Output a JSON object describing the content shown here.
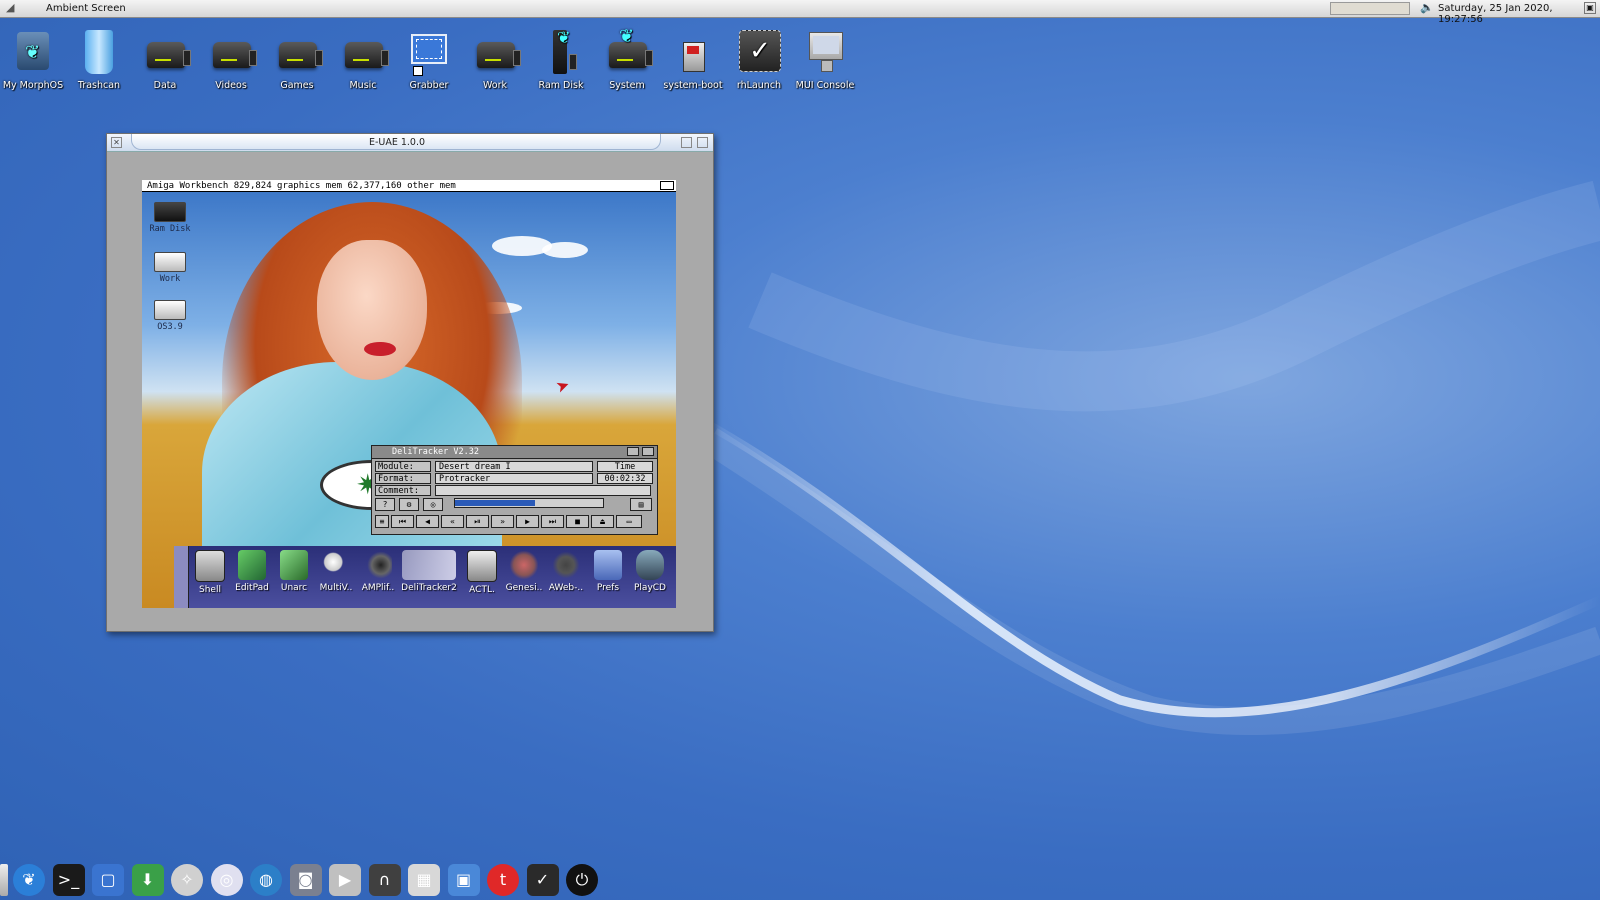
{
  "topbar": {
    "title": "Ambient Screen",
    "datetime": "Saturday, 25 Jan 2020, 19:27:56"
  },
  "desktop_icons": [
    {
      "label": "My MorphOS",
      "icon": "butterfly-icon"
    },
    {
      "label": "Trashcan",
      "icon": "trashcan-icon"
    },
    {
      "label": "Data",
      "icon": "drive-icon"
    },
    {
      "label": "Videos",
      "icon": "drive-icon"
    },
    {
      "label": "Games",
      "icon": "drive-icon"
    },
    {
      "label": "Music",
      "icon": "drive-icon"
    },
    {
      "label": "Grabber",
      "icon": "grabber-icon"
    },
    {
      "label": "Work",
      "icon": "drive-icon"
    },
    {
      "label": "Ram Disk",
      "icon": "ram-disk-icon"
    },
    {
      "label": "System",
      "icon": "system-drive-icon"
    },
    {
      "label": "system-boot",
      "icon": "boot-disk-icon"
    },
    {
      "label": "rhLaunch",
      "icon": "checkmark-launcher-icon"
    },
    {
      "label": "MUI Console",
      "icon": "monitor-icon"
    }
  ],
  "uae_window": {
    "title": "E-UAE 1.0.0",
    "workbench_bar": "Amiga Workbench  829,824 graphics mem  62,377,160 other mem",
    "wb_icons": [
      {
        "label": "Ram Disk"
      },
      {
        "label": "Work"
      },
      {
        "label": "OS3.9"
      }
    ],
    "delitracker": {
      "title": "DeliTracker V2.32",
      "module_label": "Module:",
      "module_value": "Desert dream I",
      "format_label": "Format:",
      "format_value": "Protracker",
      "comment_label": "Comment:",
      "comment_value": "",
      "time_label": "Time",
      "time_value": "00:02:32",
      "progress": 0.55
    },
    "dock_items": [
      {
        "label": "Shell"
      },
      {
        "label": "EditPad"
      },
      {
        "label": "Unarc"
      },
      {
        "label": "MultiV.."
      },
      {
        "label": "AMPlif.."
      },
      {
        "label": "DeliTracker2"
      },
      {
        "label": "ACTL."
      },
      {
        "label": "Genesi.."
      },
      {
        "label": "AWeb-.."
      },
      {
        "label": "Prefs"
      },
      {
        "label": "PlayCD"
      }
    ]
  },
  "bottom_dock": [
    {
      "icon": "morphos-butterfly-icon",
      "color": "#2b7fd8"
    },
    {
      "icon": "terminal-icon",
      "color": "#1a1a1a"
    },
    {
      "icon": "screen-grab-icon",
      "color": "#3a74d0"
    },
    {
      "icon": "download-icon",
      "color": "#3aa048"
    },
    {
      "icon": "compass-browser-icon",
      "color": "#d0d0d0"
    },
    {
      "icon": "cd-disc-icon",
      "color": "#e0e0f0"
    },
    {
      "icon": "globe-icon",
      "color": "#2c7fc8"
    },
    {
      "icon": "camera-photos-icon",
      "color": "#7a8090"
    },
    {
      "icon": "media-player-icon",
      "color": "#c0c0c0"
    },
    {
      "icon": "headphones-icon",
      "color": "#404040"
    },
    {
      "icon": "film-strip-icon",
      "color": "#d8d8d8"
    },
    {
      "icon": "network-monitor-icon",
      "color": "#4a88d8"
    },
    {
      "icon": "twitter-bird-icon",
      "color": "#e02828"
    },
    {
      "icon": "checkmark-launcher-icon",
      "color": "#2a2a2a"
    },
    {
      "icon": "power-icon",
      "color": "#111111"
    }
  ]
}
